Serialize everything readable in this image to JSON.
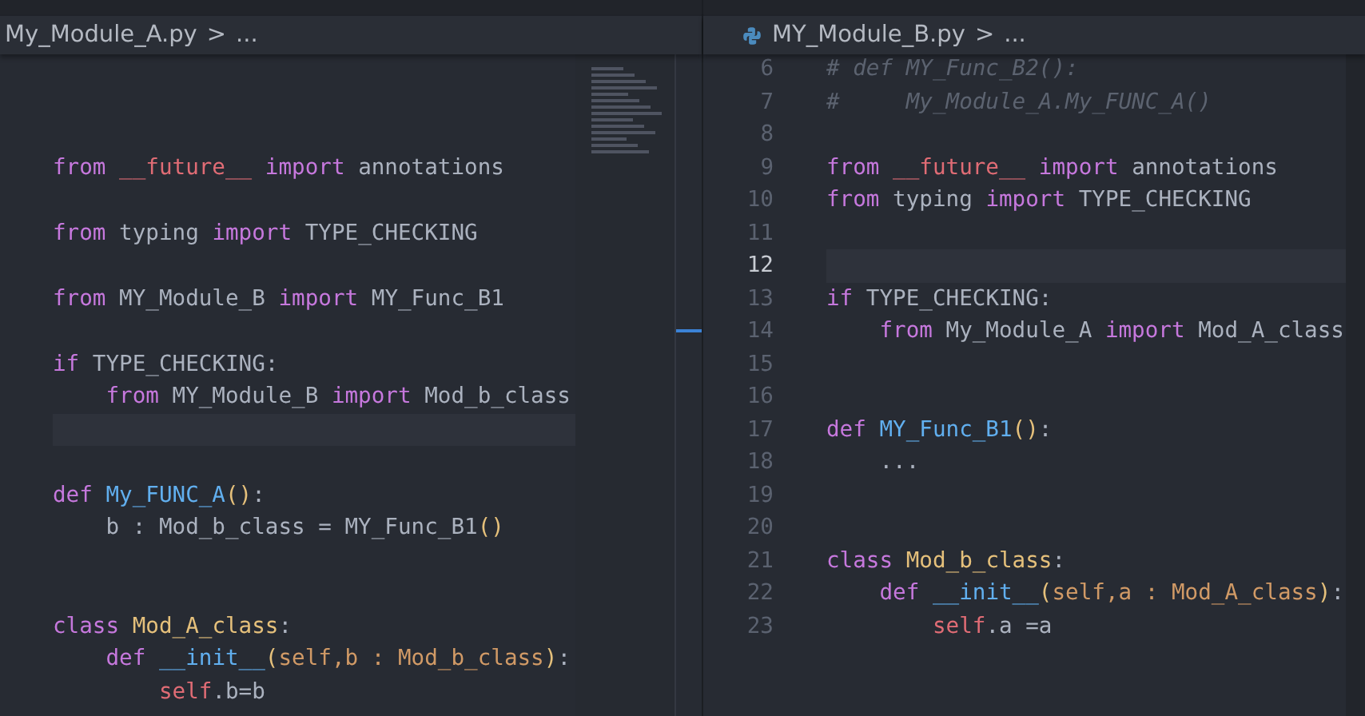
{
  "panes": [
    {
      "breadcrumb": {
        "file": "My_Module_A.py",
        "separator": ">",
        "more": "..."
      },
      "file_icon": false,
      "minimap": true,
      "lines": [
        {
          "current": false
        },
        {
          "current": false
        },
        {
          "current": false
        },
        {
          "current": false,
          "tokens": [
            {
              "text": "from",
              "kind": "kw"
            },
            {
              "text": " __future__",
              "kind": "mod"
            },
            {
              "text": " import",
              "kind": "kw"
            },
            {
              "text": " annotations",
              "kind": "plain"
            }
          ]
        },
        {
          "current": false
        },
        {
          "current": false,
          "tokens": [
            {
              "text": "from",
              "kind": "kw"
            },
            {
              "text": " typing",
              "kind": "plain"
            },
            {
              "text": " import",
              "kind": "kw"
            },
            {
              "text": " TYPE_CHECKING",
              "kind": "plain"
            }
          ]
        },
        {
          "current": false
        },
        {
          "current": false,
          "tokens": [
            {
              "text": "from",
              "kind": "kw"
            },
            {
              "text": " MY_Module_B",
              "kind": "plain"
            },
            {
              "text": " import",
              "kind": "kw"
            },
            {
              "text": " MY_Func_B1",
              "kind": "plain"
            }
          ]
        },
        {
          "current": false
        },
        {
          "current": false,
          "tokens": [
            {
              "text": "if",
              "kind": "kw"
            },
            {
              "text": " TYPE_CHECKING:",
              "kind": "plain"
            }
          ]
        },
        {
          "current": false,
          "tokens": [
            {
              "text": "    from",
              "kind": "kw"
            },
            {
              "text": " MY_Module_B",
              "kind": "plain"
            },
            {
              "text": " import",
              "kind": "kw"
            },
            {
              "text": " Mod_b_class",
              "kind": "plain"
            }
          ]
        },
        {
          "current": true
        },
        {
          "current": false
        },
        {
          "current": false,
          "tokens": [
            {
              "text": "def",
              "kind": "kw"
            },
            {
              "text": " My_FUNC_A",
              "kind": "func"
            },
            {
              "text": "()",
              "kind": "paren"
            },
            {
              "text": ":",
              "kind": "plain"
            }
          ]
        },
        {
          "current": false,
          "tokens": [
            {
              "text": "    b : Mod_b_class = MY_Func_B1",
              "kind": "plain"
            },
            {
              "text": "()",
              "kind": "paren"
            }
          ]
        },
        {
          "current": false
        },
        {
          "current": false
        },
        {
          "current": false,
          "tokens": [
            {
              "text": "class",
              "kind": "kw"
            },
            {
              "text": " Mod_A_class",
              "kind": "class"
            },
            {
              "text": ":",
              "kind": "plain"
            }
          ]
        },
        {
          "current": false,
          "tokens": [
            {
              "text": "    def",
              "kind": "kw"
            },
            {
              "text": " __init__",
              "kind": "func"
            },
            {
              "text": "(",
              "kind": "paren"
            },
            {
              "text": "self,b : Mod_b_class",
              "kind": "param"
            },
            {
              "text": ")",
              "kind": "paren"
            },
            {
              "text": ":",
              "kind": "plain"
            }
          ]
        },
        {
          "current": false,
          "tokens": [
            {
              "text": "        self",
              "kind": "self"
            },
            {
              "text": ".b=b",
              "kind": "plain"
            }
          ]
        }
      ]
    },
    {
      "breadcrumb": {
        "file": "MY_Module_B.py",
        "separator": ">",
        "more": "..."
      },
      "file_icon": true,
      "minimap": false,
      "lines": [
        {
          "number": "6",
          "current": false,
          "tokens": [
            {
              "text": "# def MY_Func_B2():",
              "kind": "comment"
            }
          ]
        },
        {
          "number": "7",
          "current": false,
          "tokens": [
            {
              "text": "#     My_Module_A.My_FUNC_A()",
              "kind": "comment"
            }
          ]
        },
        {
          "number": "8",
          "current": false
        },
        {
          "number": "9",
          "current": false,
          "tokens": [
            {
              "text": "from",
              "kind": "kw"
            },
            {
              "text": " __future__",
              "kind": "mod"
            },
            {
              "text": " import",
              "kind": "kw"
            },
            {
              "text": " annotations",
              "kind": "plain"
            }
          ]
        },
        {
          "number": "10",
          "current": false,
          "tokens": [
            {
              "text": "from",
              "kind": "kw"
            },
            {
              "text": " typing",
              "kind": "plain"
            },
            {
              "text": " import",
              "kind": "kw"
            },
            {
              "text": " TYPE_CHECKING",
              "kind": "plain"
            }
          ]
        },
        {
          "number": "11",
          "current": false
        },
        {
          "number": "12",
          "current": true
        },
        {
          "number": "13",
          "current": false,
          "tokens": [
            {
              "text": "if",
              "kind": "kw"
            },
            {
              "text": " TYPE_CHECKING:",
              "kind": "plain"
            }
          ]
        },
        {
          "number": "14",
          "current": false,
          "tokens": [
            {
              "text": "    from",
              "kind": "kw"
            },
            {
              "text": " My_Module_A",
              "kind": "plain"
            },
            {
              "text": " import",
              "kind": "kw"
            },
            {
              "text": " Mod_A_class",
              "kind": "plain"
            }
          ]
        },
        {
          "number": "15",
          "current": false
        },
        {
          "number": "16",
          "current": false
        },
        {
          "number": "17",
          "current": false,
          "tokens": [
            {
              "text": "def",
              "kind": "kw"
            },
            {
              "text": " MY_Func_B1",
              "kind": "func"
            },
            {
              "text": "()",
              "kind": "paren"
            },
            {
              "text": ":",
              "kind": "plain"
            }
          ]
        },
        {
          "number": "18",
          "current": false,
          "tokens": [
            {
              "text": "    ...",
              "kind": "plain"
            }
          ]
        },
        {
          "number": "19",
          "current": false
        },
        {
          "number": "20",
          "current": false
        },
        {
          "number": "21",
          "current": false,
          "tokens": [
            {
              "text": "class",
              "kind": "kw"
            },
            {
              "text": " Mod_b_class",
              "kind": "class"
            },
            {
              "text": ":",
              "kind": "plain"
            }
          ]
        },
        {
          "number": "22",
          "current": false,
          "tokens": [
            {
              "text": "    def",
              "kind": "kw"
            },
            {
              "text": " __init__",
              "kind": "func"
            },
            {
              "text": "(",
              "kind": "paren"
            },
            {
              "text": "self,a : Mod_A_class",
              "kind": "param"
            },
            {
              "text": ")",
              "kind": "paren"
            },
            {
              "text": ":",
              "kind": "plain"
            }
          ]
        },
        {
          "number": "23",
          "current": false,
          "tokens": [
            {
              "text": "        self",
              "kind": "self"
            },
            {
              "text": ".a =a",
              "kind": "plain"
            }
          ]
        }
      ]
    }
  ]
}
